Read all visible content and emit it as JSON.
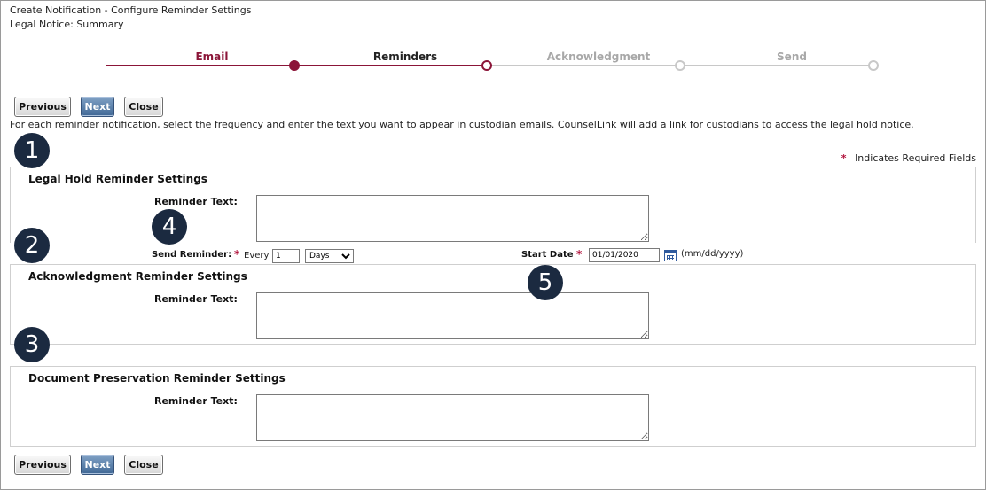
{
  "header": {
    "title": "Create Notification - Configure Reminder Settings",
    "subtitle": "Legal Notice: Summary"
  },
  "wizard": {
    "steps": [
      {
        "label": "Email",
        "state": "complete"
      },
      {
        "label": "Reminders",
        "state": "current"
      },
      {
        "label": "Acknowledgment",
        "state": "pending"
      },
      {
        "label": "Send",
        "state": "pending"
      }
    ],
    "colors": {
      "complete": "#8b1538",
      "current_text": "#222222",
      "pending": "#c8c8c8",
      "pending_text": "#a8a8a8"
    }
  },
  "toolbar": {
    "previous_label": "Previous",
    "next_label": "Next",
    "close_label": "Close"
  },
  "intro": "For each reminder notification, select the frequency and enter the text you want to appear in custodian emails. CounselLink will add a link for custodians to access the legal hold notice.",
  "required_note": {
    "symbol": "*",
    "text": "Indicates Required Fields"
  },
  "sections": {
    "legal_hold": {
      "title": "Legal Hold Reminder Settings",
      "reminder_text_label": "Reminder Text:",
      "reminder_text_value": "",
      "send_reminder_label": "Send Reminder:",
      "every_label": "Every",
      "frequency_value": "1",
      "frequency_unit": "Days",
      "start_date_label": "Start Date",
      "start_date_value": "01/01/2020",
      "date_format_hint": "(mm/dd/yyyy)"
    },
    "acknowledgment": {
      "title": "Acknowledgment Reminder Settings",
      "reminder_text_label": "Reminder Text:",
      "reminder_text_value": ""
    },
    "preservation": {
      "title": "Document Preservation Reminder Settings",
      "reminder_text_label": "Reminder Text:",
      "reminder_text_value": ""
    }
  },
  "callouts": [
    "1",
    "2",
    "3",
    "4",
    "5"
  ]
}
